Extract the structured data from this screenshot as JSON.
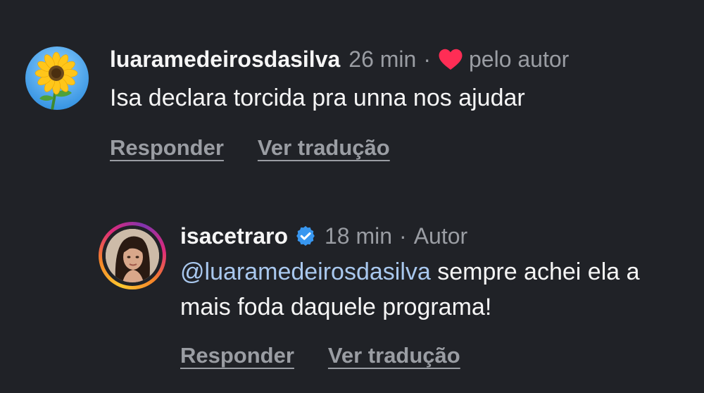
{
  "colors": {
    "background": "#202227",
    "primary_text": "#f5f5f5",
    "secondary_text": "#9a9da3",
    "mention": "#a9c8ee",
    "like_heart": "#ff2d55",
    "verified_badge": "#3897f0"
  },
  "comment": {
    "avatar_icon": "sunflower-avatar",
    "username": "luaramedeirosdasilva",
    "time": "26 min",
    "separator": "·",
    "liked_icon": "heart-icon",
    "liked_by_author": "pelo autor",
    "text": "Isa declara torcida pra unna nos ajudar",
    "reply_label": "Responder",
    "translate_label": "Ver tradução"
  },
  "reply": {
    "avatar_icon": "profile-photo-avatar",
    "username": "isacetraro",
    "verified_icon": "verified-badge-icon",
    "time": "18 min",
    "separator": "·",
    "author_label": "Autor",
    "mention": "@luaramedeirosdasilva",
    "text": " sempre achei ela a mais foda daquele programa!",
    "reply_label": "Responder",
    "translate_label": "Ver tradução"
  }
}
